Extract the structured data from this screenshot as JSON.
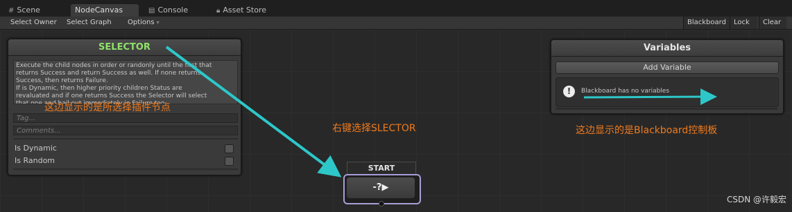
{
  "tabs": [
    {
      "label": "Scene",
      "icon": "grid-icon"
    },
    {
      "label": "NodeCanvas",
      "icon": ""
    },
    {
      "label": "Console",
      "icon": "console-icon"
    },
    {
      "label": "Asset Store",
      "icon": "lock-icon"
    }
  ],
  "toolbar": {
    "select_owner": "Select Owner",
    "select_graph": "Select Graph",
    "options": "Options",
    "blackboard": "Blackboard",
    "lock": "Lock",
    "clear": "Clear"
  },
  "selector_panel": {
    "title": "SELECTOR",
    "title_color": "#8fe36a",
    "description": "Execute the child nodes in order or randonly until the first that\nreturns Success and return Success as well. If none returns\nSuccess, then returns Failure.\nIf is Dynamic, then higher priority children Status are\nrevaluated and if one returns Success the Selector will select\nthat one and bail out immediately in Failure too",
    "tag_placeholder": "Tag...",
    "comments_placeholder": "Comments...",
    "is_dynamic_label": "Is Dynamic",
    "is_random_label": "Is Random"
  },
  "variables_panel": {
    "title": "Variables",
    "add_variable": "Add Variable",
    "warn_icon_glyph": "!",
    "empty_message": "Blackboard has no variables"
  },
  "start_node": {
    "label": "START",
    "icon_glyph": "-?▶"
  },
  "annotations": {
    "left_note": "这边显示的是所选择插件节点",
    "center_note": "右键选择SLECTOR",
    "right_note": "这边显示的是Blackboard控制板",
    "color": "#f07b1e",
    "arrow_color": "#2ec7c9"
  },
  "watermark": "CSDN @许毅宏"
}
